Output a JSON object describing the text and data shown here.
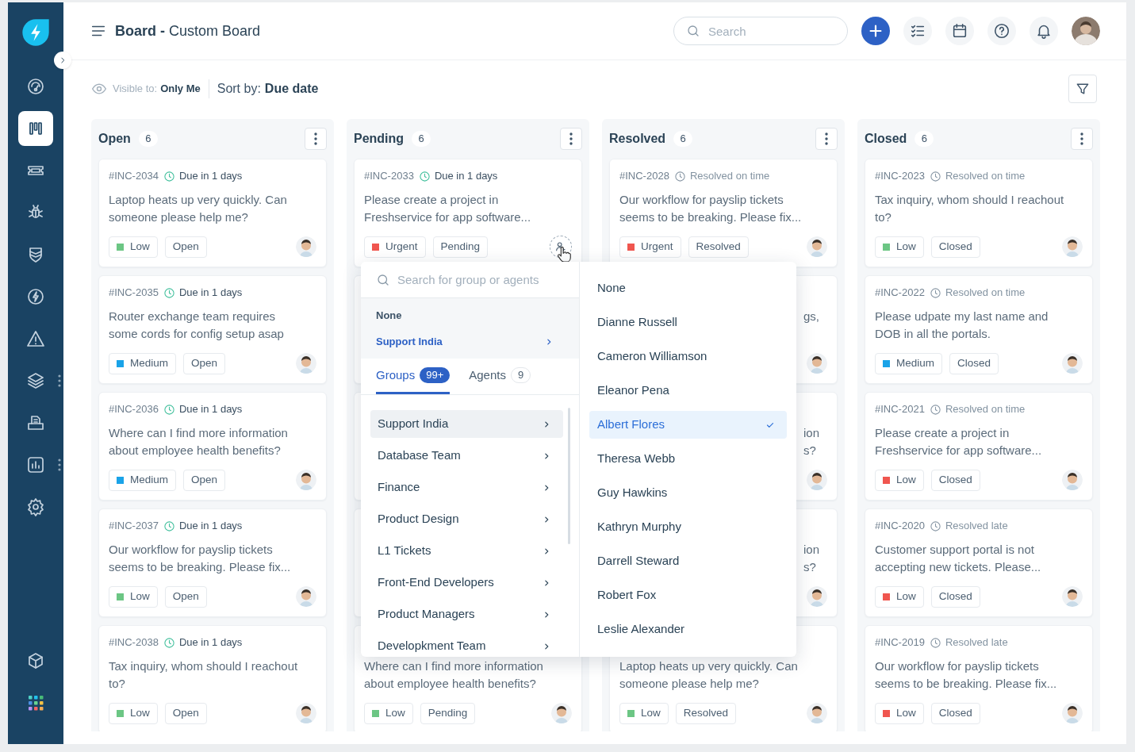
{
  "header": {
    "title": "**Board -** Custom Board",
    "search": {
      "placeholder": "Search"
    }
  },
  "sidebar": {
    "items": [
      {
        "selected": false,
        "has_menu": false
      },
      {
        "selected": true,
        "has_menu": false
      },
      {
        "selected": false,
        "has_menu": false
      },
      {
        "selected": false,
        "has_menu": false
      },
      {
        "selected": false,
        "has_menu": false
      },
      {
        "selected": false,
        "has_menu": false
      },
      {
        "selected": false,
        "has_menu": false
      },
      {
        "selected": false,
        "has_menu": true
      },
      {
        "selected": false,
        "has_menu": false
      },
      {
        "selected": false,
        "has_menu": true
      },
      {
        "selected": false,
        "has_menu": false
      }
    ],
    "bottom_items": [
      {
        "selected": false
      },
      {
        "selected": false
      }
    ]
  },
  "toolbar": {
    "visible_label": "Visible to:",
    "visible_value": "Only Me",
    "sort_label": "Sort by:",
    "sort_value": "Due date"
  },
  "columns": [
    {
      "title": "Open",
      "count": "6",
      "cards": [
        {
          "kind": "full",
          "id": "#INC-2034",
          "due_highlight": true,
          "due": "Due in 1 days",
          "title": "Laptop heats up very quickly. Can someone please help me?",
          "priority": "Low",
          "color": "#6cc684",
          "status": "Open",
          "assigned": true
        },
        {
          "kind": "full",
          "id": "#INC-2035",
          "due_highlight": true,
          "due": "Due in 1 days",
          "title": "Router exchange team requires some cords for config setup asap",
          "priority": "Medium",
          "color": "#1aa3e8",
          "status": "Open",
          "assigned": true
        },
        {
          "kind": "full",
          "id": "#INC-2036",
          "due_highlight": true,
          "due": "Due in 1 days",
          "title": "Where can I find more information about employee health benefits?",
          "priority": "Medium",
          "color": "#1aa3e8",
          "status": "Open",
          "assigned": true
        },
        {
          "kind": "full",
          "id": "#INC-2037",
          "due_highlight": true,
          "due": "Due in 1 days",
          "title": "Our workflow for payslip tickets seems to be breaking. Please fix...",
          "priority": "Low",
          "color": "#6cc684",
          "status": "Open",
          "assigned": true
        },
        {
          "kind": "full",
          "id": "#INC-2038",
          "due_highlight": true,
          "due": "Due in 1 days",
          "title": "Tax inquiry, whom should I reachout to?",
          "priority": "Low",
          "color": "#6cc684",
          "status": "Open",
          "assigned": true
        }
      ]
    },
    {
      "title": "Pending",
      "count": "6",
      "cards": [
        {
          "kind": "full",
          "id": "#INC-2033",
          "due_highlight": true,
          "due": "Due in 1 days",
          "title": "Please create a project in Freshservice for app software...",
          "priority": "Urgent",
          "color": "#f0564f",
          "status": "Pending",
          "assigned": false
        },
        {
          "kind": "hidden"
        },
        {
          "kind": "hidden"
        },
        {
          "kind": "hidden"
        },
        {
          "kind": "lower",
          "title": "Where can I find more information about employee health benefits?",
          "priority": "Low",
          "color": "#6cc684",
          "status": "Pending",
          "assigned": true
        }
      ]
    },
    {
      "title": "Resolved",
      "count": "6",
      "cards": [
        {
          "kind": "full",
          "id": "#INC-2028",
          "due_highlight": false,
          "due": "Resolved on time",
          "title": "Our workflow for payslip tickets seems to be breaking. Please fix...",
          "priority": "Urgent",
          "color": "#f0564f",
          "status": "Resolved",
          "assigned": true
        },
        {
          "kind": "clipped",
          "fragments": [
            "gs,"
          ],
          "assigned": true
        },
        {
          "kind": "clipped",
          "fragments": [
            "ion",
            "s?"
          ],
          "assigned": true
        },
        {
          "kind": "clipped",
          "fragments": [
            "ion",
            "s?"
          ],
          "assigned": true
        },
        {
          "kind": "lower",
          "title": "Laptop heats up very quickly. Can someone please help me?",
          "priority": "Low",
          "color": "#6cc684",
          "status": "Resolved",
          "assigned": true
        }
      ]
    },
    {
      "title": "Closed",
      "count": "6",
      "cards": [
        {
          "kind": "full",
          "id": "#INC-2023",
          "due_highlight": false,
          "due": "Resolved on time",
          "title": "Tax inquiry, whom should I reachout to?",
          "priority": "Low",
          "color": "#6cc684",
          "status": "Closed",
          "assigned": true
        },
        {
          "kind": "full",
          "id": "#INC-2022",
          "due_highlight": false,
          "due": "Resolved on time",
          "title": "Please udpate my last name and DOB in all the portals.",
          "priority": "Medium",
          "color": "#1aa3e8",
          "status": "Closed",
          "assigned": true
        },
        {
          "kind": "full",
          "id": "#INC-2021",
          "due_highlight": false,
          "due": "Resolved on time",
          "title": "Please create a project in Freshservice for app software...",
          "priority": "Low",
          "color": "#f0564f",
          "status": "Closed",
          "assigned": true
        },
        {
          "kind": "full",
          "id": "#INC-2020",
          "due_highlight": false,
          "due": "Resolved late",
          "title": "Customer support portal is not accepting new tickets. Please...",
          "priority": "Low",
          "color": "#f0564f",
          "status": "Closed",
          "assigned": true
        },
        {
          "kind": "full",
          "id": "#INC-2019",
          "due_highlight": false,
          "due": "Resolved late",
          "title": "Our workflow for payslip tickets seems to be breaking. Please fix...",
          "priority": "Low",
          "color": "#f0564f",
          "status": "Closed",
          "assigned": true
        }
      ]
    }
  ],
  "assign_dropdown": {
    "search": {
      "placeholder": "Search for group or agents"
    },
    "current": {
      "none_label": "None",
      "group": "Support India"
    },
    "tabs": [
      {
        "label": "Groups",
        "count": "99+",
        "selected": true
      },
      {
        "label": "Agents",
        "count": "9",
        "selected": false
      }
    ],
    "groups": [
      {
        "label": "Support India",
        "selected": true
      },
      {
        "label": "Database Team",
        "selected": false
      },
      {
        "label": "Finance",
        "selected": false
      },
      {
        "label": "Product Design",
        "selected": false
      },
      {
        "label": "L1 Tickets",
        "selected": false
      },
      {
        "label": "Front-End Developers",
        "selected": false
      },
      {
        "label": "Product Managers",
        "selected": false
      },
      {
        "label": "Developkment Team",
        "selected": false
      }
    ],
    "agents": [
      {
        "label": "None",
        "selected": false
      },
      {
        "label": "Dianne Russell",
        "selected": false
      },
      {
        "label": "Cameron Williamson",
        "selected": false
      },
      {
        "label": "Eleanor Pena",
        "selected": false
      },
      {
        "label": "Albert Flores",
        "selected": true
      },
      {
        "label": "Theresa Webb",
        "selected": false
      },
      {
        "label": "Guy Hawkins",
        "selected": false
      },
      {
        "label": "Kathryn Murphy",
        "selected": false
      },
      {
        "label": "Darrell Steward",
        "selected": false
      },
      {
        "label": "Robert Fox",
        "selected": false
      },
      {
        "label": "Leslie Alexander",
        "selected": false
      }
    ]
  }
}
